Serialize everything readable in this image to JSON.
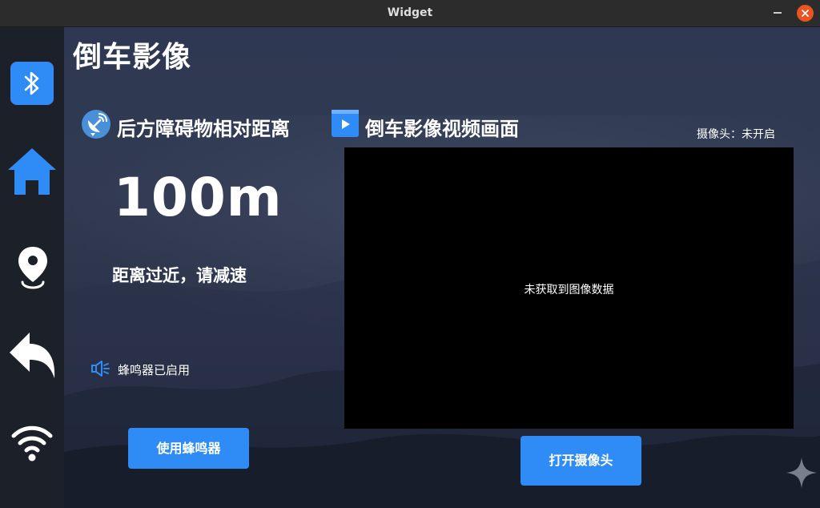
{
  "window": {
    "title": "Widget"
  },
  "sidebar": {
    "items": [
      {
        "icon": "bluetooth-icon",
        "active": true
      },
      {
        "icon": "home-icon"
      },
      {
        "icon": "location-pin-icon"
      },
      {
        "icon": "back-arrow-icon"
      },
      {
        "icon": "wifi-icon"
      }
    ]
  },
  "page": {
    "title": "倒车影像"
  },
  "obstacle": {
    "heading": "后方障碍物相对距离",
    "distance": "100m",
    "warning": "距离过近，请减速",
    "buzzer_status": "蜂鸣器已启用",
    "buzzer_button": "使用蜂鸣器"
  },
  "video": {
    "heading": "倒车影像视频画面",
    "camera_status": "摄像头：未开启",
    "no_data_message": "未获取到图像数据",
    "open_camera_button": "打开摄像头"
  },
  "colors": {
    "accent": "#2f8bf5",
    "sidebar_bg": "#1c2029",
    "titlebar_bg": "#2c2c2c",
    "close_button": "#e95420",
    "video_bg": "#000000"
  }
}
